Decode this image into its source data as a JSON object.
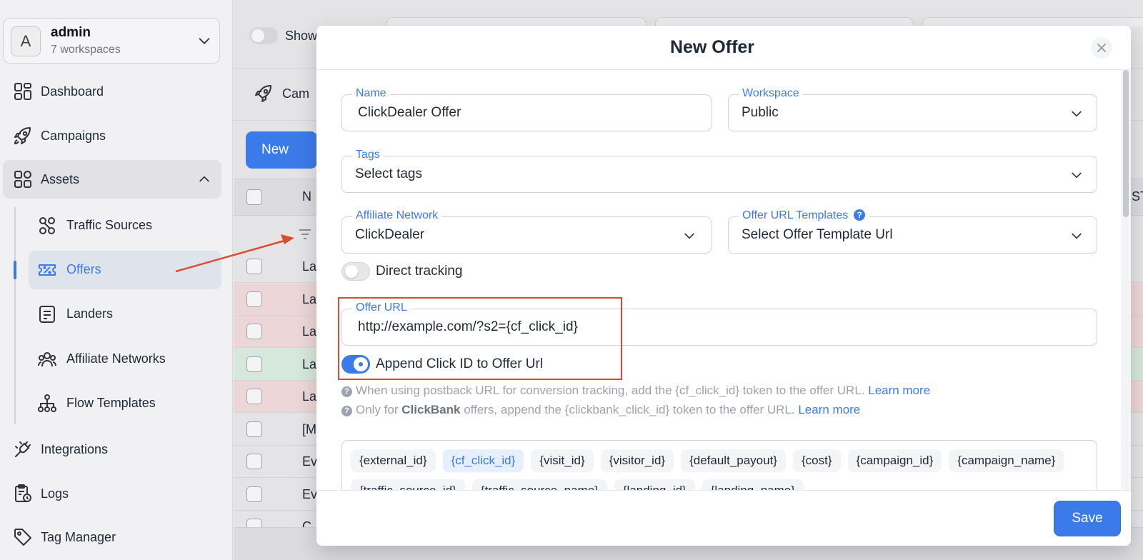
{
  "workspace": {
    "avatar_letter": "A",
    "name": "admin",
    "count": "7 workspaces"
  },
  "nav": {
    "dashboard": "Dashboard",
    "campaigns": "Campaigns",
    "assets": "Assets",
    "traffic_sources": "Traffic Sources",
    "offers": "Offers",
    "landers": "Landers",
    "affiliate_networks": "Affiliate Networks",
    "flow_templates": "Flow Templates",
    "integrations": "Integrations",
    "logs": "Logs",
    "tag_manager": "Tag Manager"
  },
  "background": {
    "show_label": "Show",
    "campaigns_tab": "Cam",
    "new_button": "New",
    "header_col": "N",
    "right_header": "ST",
    "rows": [
      "La",
      "La",
      "La",
      "La",
      "La",
      "[M",
      "Ev",
      "Ev",
      "C"
    ],
    "row_colors": [
      "#e4e4e6",
      "#ecd6d8",
      "#ecd6d8",
      "#d6e7dc",
      "#ecd6d8",
      "#e4e4e6",
      "#e4e4e6",
      "#e4e4e6",
      "#e4e4e6"
    ]
  },
  "modal": {
    "title": "New Offer",
    "name_label": "Name",
    "name_value": "ClickDealer Offer",
    "workspace_label": "Workspace",
    "workspace_value": "Public",
    "tags_label": "Tags",
    "tags_placeholder": "Select tags",
    "network_label": "Affiliate Network",
    "network_value": "ClickDealer",
    "template_label": "Offer URL Templates",
    "template_value": "Select Offer Template Url",
    "direct_tracking": "Direct tracking",
    "offer_url_label": "Offer URL",
    "offer_url_value": "http://example.com/?s2={cf_click_id}",
    "append_click_id": "Append Click ID to Offer Url",
    "hint1_text": "When using postback URL for conversion tracking, add the {cf_click_id} token to the offer URL.",
    "hint1_link": "Learn more",
    "hint2_pre": "Only for",
    "hint2_bold": "ClickBank",
    "hint2_post": "offers, append the {clickbank_click_id} token to the offer URL.",
    "hint2_link": "Learn more",
    "tokens": [
      "{external_id}",
      "{cf_click_id}",
      "{visit_id}",
      "{visitor_id}",
      "{default_payout}",
      "{cost}",
      "{campaign_id}",
      "{campaign_name}",
      "{traffic_source_id}",
      "{traffic_source_name}",
      "{landing_id}",
      "{landing_name}"
    ],
    "active_token": "{cf_click_id}",
    "save_button": "Save"
  },
  "colors": {
    "accent": "#3b7be9",
    "annotation": "#dd4b2e"
  }
}
